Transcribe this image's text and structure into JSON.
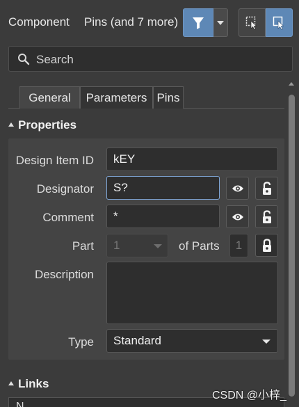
{
  "header": {
    "title": "Component",
    "subtitle": "Pins (and 7 more)"
  },
  "search": {
    "placeholder": "Search"
  },
  "tabs": [
    {
      "label": "General",
      "active": true
    },
    {
      "label": "Parameters",
      "active": false
    },
    {
      "label": "Pins",
      "active": false
    }
  ],
  "properties": {
    "section_label": "Properties",
    "design_item_id": {
      "label": "Design Item ID",
      "value": "kEY"
    },
    "designator": {
      "label": "Designator",
      "value": "S?"
    },
    "comment": {
      "label": "Comment",
      "value": "*"
    },
    "part": {
      "label": "Part",
      "value": "1",
      "of_parts_label": "of Parts",
      "parts_count": "1"
    },
    "description": {
      "label": "Description",
      "value": ""
    },
    "type": {
      "label": "Type",
      "value": "Standard"
    }
  },
  "links": {
    "section_label": "Links",
    "first_row_partial": "N"
  },
  "watermark": "CSDN @小梓_",
  "colors": {
    "accent": "#5e88b6",
    "background": "#3b3b3b",
    "panel": "#444444",
    "field": "#2e2e2e"
  },
  "icons": {
    "filter": "filter-icon",
    "dropdown": "chevron-down-icon",
    "select_inside": "select-inside-icon",
    "select_touching": "select-touching-icon",
    "search": "search-icon",
    "visibility": "eye-icon",
    "lock": "lock-icon"
  }
}
